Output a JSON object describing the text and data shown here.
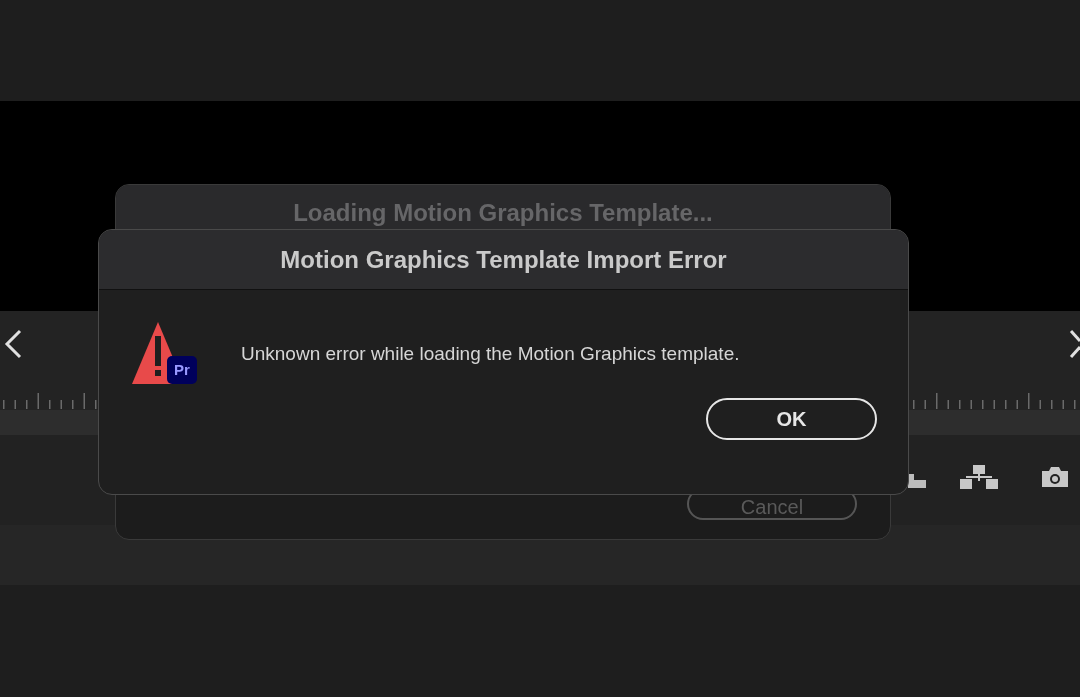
{
  "background_dialog": {
    "title": "Loading Motion Graphics Template...",
    "buttons": [
      "Cancel"
    ]
  },
  "dialog": {
    "title": "Motion Graphics Template Import Error",
    "badge": "Pr",
    "message": "Unknown error while loading the Motion Graphics template.",
    "buttons": [
      "OK"
    ]
  }
}
